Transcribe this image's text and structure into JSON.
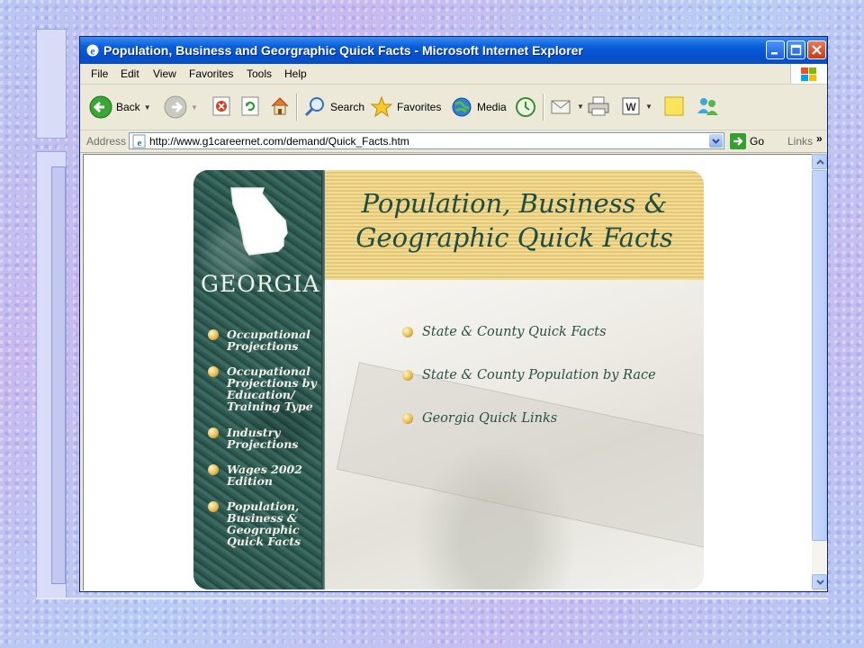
{
  "window": {
    "title": "Population, Business and Georgraphic Quick Facts - Microsoft Internet Explorer"
  },
  "menu": [
    "File",
    "Edit",
    "View",
    "Favorites",
    "Tools",
    "Help"
  ],
  "toolbar": {
    "back": "Back",
    "search": "Search",
    "favorites": "Favorites",
    "media": "Media"
  },
  "address": {
    "label": "Address",
    "url": "http://www.g1careernet.com/demand/Quick_Facts.htm",
    "go": "Go",
    "links": "Links",
    "chevron": "»"
  },
  "page": {
    "state_name": "GEORGIA",
    "banner_line1": "Population, Business &",
    "banner_line2": "Geographic Quick Facts",
    "nav": [
      "Occupational Projections",
      "Occupational Projections by Education/ Training Type",
      "Industry Projections",
      "Wages 2002 Edition",
      "Population, Business & Geographic Quick Facts"
    ],
    "quick_links": [
      "State & County Quick Facts",
      "State & County Population by Race",
      "Georgia Quick Links"
    ]
  },
  "colors": {
    "title_bar": "#0550d0",
    "banner_gold": "#e5c870",
    "nav_green": "#2f5a52",
    "link_text": "#2a4f45"
  }
}
